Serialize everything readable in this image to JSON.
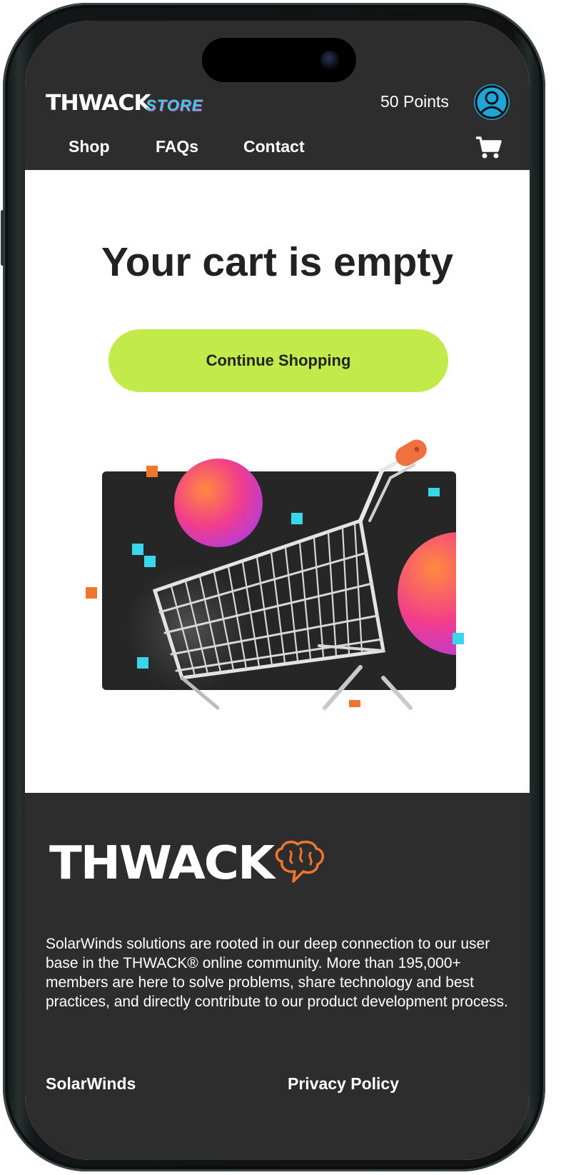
{
  "header": {
    "logo_text": "THWACK",
    "logo_sub": "STORE",
    "points": "50 Points",
    "nav": [
      {
        "label": "Shop"
      },
      {
        "label": "FAQs"
      },
      {
        "label": "Contact"
      }
    ]
  },
  "main": {
    "title": "Your cart is empty",
    "cta_label": "Continue Shopping"
  },
  "footer": {
    "logo_text": "THWACK",
    "description": "SolarWinds solutions are rooted in our deep connection to our user base in the THWACK® online community. More than 195,000+ members are here to solve problems, share technology and best practices, and directly contribute to our product development process.",
    "links": [
      {
        "label": "SolarWinds"
      },
      {
        "label": "Privacy Policy"
      }
    ]
  },
  "colors": {
    "header_bg": "#2d2d2d",
    "cta_bg": "#c2ea4b",
    "accent_cyan": "#3ec9e6",
    "accent_orange": "#f0762d",
    "user_icon": "#1fa6d8"
  },
  "icons": [
    "user-icon",
    "cart-icon",
    "brain-icon",
    "shopping-cart-illustration"
  ]
}
